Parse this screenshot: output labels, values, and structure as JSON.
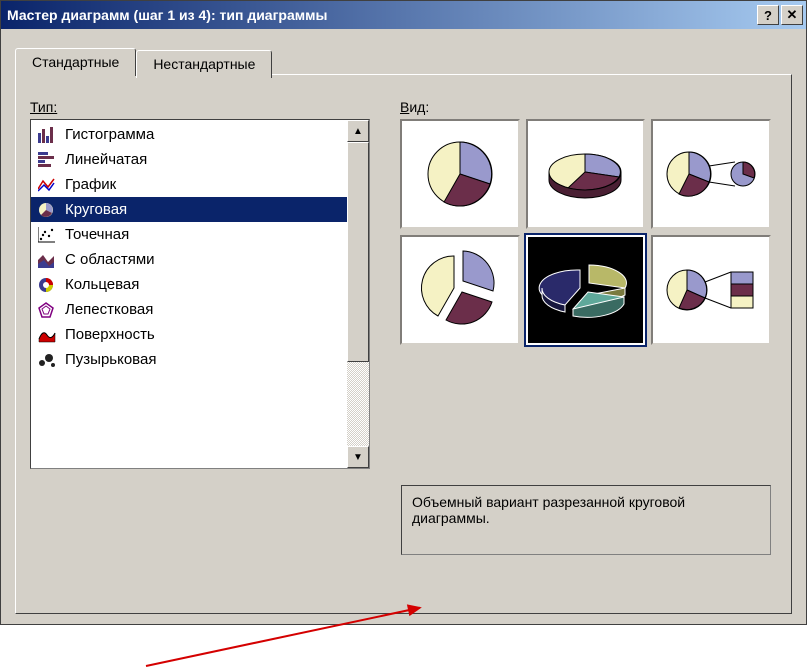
{
  "window": {
    "title": "Мастер диаграмм (шаг 1 из 4): тип диаграммы"
  },
  "tabs": {
    "standard": "Стандартные",
    "custom": "Нестандартные"
  },
  "labels": {
    "type": "Тип:",
    "view": "Вид:"
  },
  "chart_types": [
    {
      "id": "histogram",
      "label": "Гистограмма"
    },
    {
      "id": "bar",
      "label": "Линейчатая"
    },
    {
      "id": "line",
      "label": "График"
    },
    {
      "id": "pie",
      "label": "Круговая"
    },
    {
      "id": "scatter",
      "label": "Точечная"
    },
    {
      "id": "area",
      "label": "С областями"
    },
    {
      "id": "doughnut",
      "label": "Кольцевая"
    },
    {
      "id": "radar",
      "label": "Лепестковая"
    },
    {
      "id": "surface",
      "label": "Поверхность"
    },
    {
      "id": "bubble",
      "label": "Пузырьковая"
    }
  ],
  "selected_type_index": 3,
  "selected_subtype_index": 4,
  "description": "Объемный вариант разрезанной круговой диаграммы.",
  "colors": {
    "selection": "#0a246a",
    "bg": "#d4d0c8",
    "slice1": "#9999cc",
    "slice2": "#f5f2c4",
    "slice3": "#6b2e4a"
  }
}
